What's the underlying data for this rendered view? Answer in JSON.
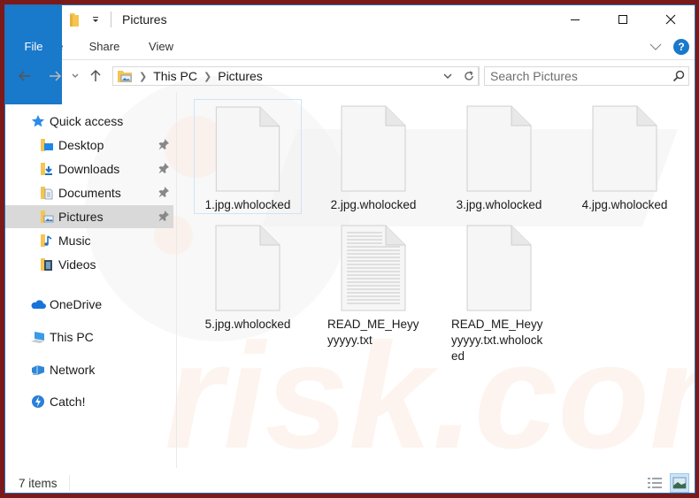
{
  "window": {
    "title": "Pictures",
    "controls": {
      "minimize": "—",
      "maximize": "☐",
      "close": "✕"
    }
  },
  "ribbon": {
    "tabs": [
      {
        "label": "File",
        "active": true
      },
      {
        "label": "Home"
      },
      {
        "label": "Share"
      },
      {
        "label": "View"
      }
    ],
    "help_label": "?"
  },
  "navigation": {
    "back": "←",
    "forward": "→",
    "recent": "⌄",
    "up": "↑",
    "breadcrumb": [
      "This PC",
      "Pictures"
    ],
    "search_placeholder": "Search Pictures",
    "search_value": ""
  },
  "sidebar": {
    "items": [
      {
        "label": "Quick access",
        "icon": "star-icon",
        "pinned": false
      },
      {
        "label": "Desktop",
        "icon": "desktop-folder-icon",
        "pinned": true
      },
      {
        "label": "Downloads",
        "icon": "downloads-folder-icon",
        "pinned": true
      },
      {
        "label": "Documents",
        "icon": "documents-folder-icon",
        "pinned": true
      },
      {
        "label": "Pictures",
        "icon": "pictures-folder-icon",
        "pinned": true,
        "selected": true
      },
      {
        "label": "Music",
        "icon": "music-folder-icon",
        "pinned": false
      },
      {
        "label": "Videos",
        "icon": "videos-folder-icon",
        "pinned": false
      },
      {
        "label": "OneDrive",
        "icon": "onedrive-icon"
      },
      {
        "label": "This PC",
        "icon": "this-pc-icon"
      },
      {
        "label": "Network",
        "icon": "network-icon"
      },
      {
        "label": "Catch!",
        "icon": "catch-icon"
      }
    ]
  },
  "files": [
    {
      "name": "1.jpg.wholocked",
      "type": "blank",
      "selected": true
    },
    {
      "name": "2.jpg.wholocked",
      "type": "blank"
    },
    {
      "name": "3.jpg.wholocked",
      "type": "blank"
    },
    {
      "name": "4.jpg.wholocked",
      "type": "blank"
    },
    {
      "name": "5.jpg.wholocked",
      "type": "blank"
    },
    {
      "name": "READ_ME_Heyyyyyyy.txt",
      "type": "text"
    },
    {
      "name": "READ_ME_Heyyyyyyy.txt.wholocked",
      "type": "blank"
    }
  ],
  "status": {
    "item_count": "7 items"
  },
  "colors": {
    "accent": "#1979ca",
    "selection": "#cce4f7",
    "sidebar_selected": "#d9d9d9",
    "desktop_background": "#7a1a1a"
  }
}
